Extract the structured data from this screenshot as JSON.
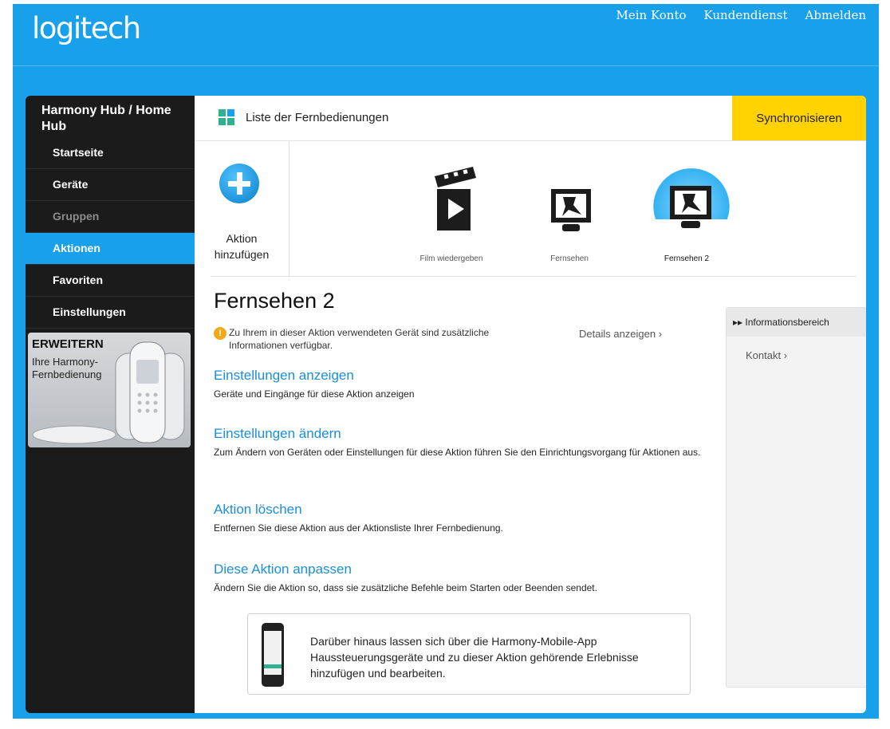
{
  "brand": {
    "logo": "logitech"
  },
  "top_nav": {
    "account": "Mein Konto",
    "support": "Kundendienst",
    "logout": "Abmelden"
  },
  "sidebar": {
    "title": "Harmony Hub / Home Hub",
    "items": [
      {
        "label": "Startseite",
        "state": "normal"
      },
      {
        "label": "Geräte",
        "state": "normal"
      },
      {
        "label": "Gruppen",
        "state": "disabled"
      },
      {
        "label": "Aktionen",
        "state": "active"
      },
      {
        "label": "Favoriten",
        "state": "normal"
      },
      {
        "label": "Einstellungen",
        "state": "normal"
      }
    ],
    "promo": {
      "title": "ERWEITERN",
      "subtitle": "Ihre Harmony-Fernbedienung"
    }
  },
  "header": {
    "title": "Liste der Fernbedienungen",
    "sync_label": "Synchronisieren"
  },
  "actions": {
    "add_label_1": "Aktion",
    "add_label_2": "hinzufügen",
    "items": [
      {
        "label": "Film wiedergeben",
        "icon": "film-clapper-icon",
        "selected": false
      },
      {
        "label": "Fernsehen",
        "icon": "tv-icon",
        "selected": false
      },
      {
        "label": "Fernsehen 2",
        "icon": "tv-icon",
        "selected": true
      }
    ]
  },
  "main": {
    "title": "Fernsehen 2",
    "info_line_1": "Zu Ihrem in dieser Aktion verwendeten Gerät sind zusätzliche",
    "info_line_2": "Informationen verfügbar.",
    "details_link": "Details anzeigen",
    "sections": [
      {
        "link": "Einstellungen anzeigen",
        "desc": "Geräte und Eingänge für diese Aktion anzeigen"
      },
      {
        "link": "Einstellungen ändern",
        "desc": "Zum Ändern von Geräten oder Einstellungen für diese Aktion führen Sie den Einrichtungsvorgang für Aktionen aus."
      },
      {
        "link": "Aktion löschen",
        "desc": "Entfernen Sie diese Aktion aus der Aktionsliste Ihrer Fernbedienung."
      },
      {
        "link": "Diese Aktion anpassen",
        "desc": "Ändern Sie die Aktion so, dass sie zusätzliche Befehle beim Starten oder Beenden sendet."
      }
    ],
    "mobile_text": "Darüber hinaus lassen sich über die Harmony-Mobile-App Haussteuerungsgeräte und zu dieser Aktion gehörende Erlebnisse hinzufügen und bearbeiten."
  },
  "info_panel": {
    "title": "Informationsbereich",
    "contact": "Kontakt"
  },
  "colors": {
    "accent_blue": "#19a0eb",
    "sync_yellow": "#ffd200",
    "sidebar_bg": "#1b1b1b"
  }
}
